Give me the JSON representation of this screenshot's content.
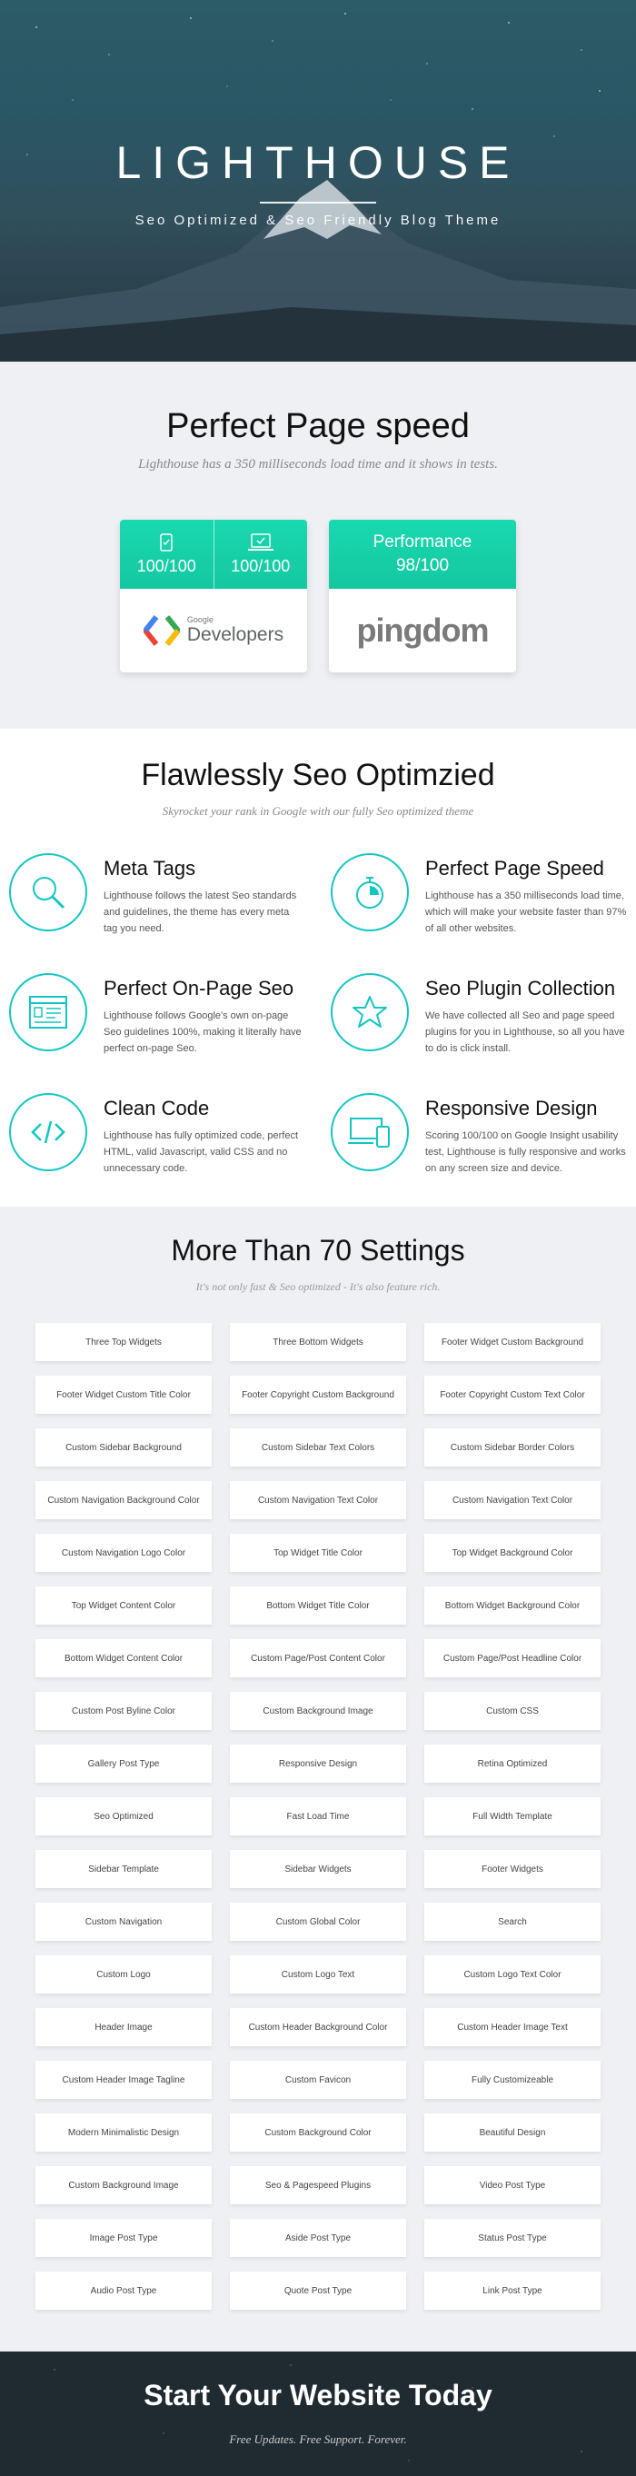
{
  "hero": {
    "title": "LIGHTHOUSE",
    "subtitle": "Seo Optimized & Seo Friendly Blog Theme"
  },
  "speed": {
    "title": "Perfect Page speed",
    "subtitle": "Lighthouse has a 350 milliseconds load time and it shows in tests.",
    "google_card": {
      "mobile_icon": "mobile-icon",
      "mobile_score": "100/100",
      "desktop_icon": "laptop-icon",
      "desktop_score": "100/100",
      "logo_small": "Google",
      "logo_text": "Developers"
    },
    "pingdom_card": {
      "label": "Performance",
      "score": "98/100",
      "logo_text": "pingdom"
    }
  },
  "seo": {
    "title": "Flawlessly Seo Optimzied",
    "subtitle": "Skyrocket your rank in Google with our fully Seo optimized theme",
    "features": [
      {
        "icon": "search-icon",
        "title": "Meta Tags",
        "text": "Lighthouse follows the latest Seo standards and guidelines, the theme has every meta tag you need."
      },
      {
        "icon": "stopwatch-icon",
        "title": "Perfect Page Speed",
        "text": "Lighthouse has a 350 milliseconds load time, which will make your website faster than 97% of all other websites."
      },
      {
        "icon": "browser-icon",
        "title": "Perfect On-Page Seo",
        "text": "Lighthouse follows Google's own on-page Seo guidelines 100%, making it literally have perfect on-page Seo."
      },
      {
        "icon": "star-icon",
        "title": "Seo Plugin Collection",
        "text": "We have collected all Seo and page speed plugins for you in Lighthouse, so all you have to do is click install."
      },
      {
        "icon": "code-icon",
        "title": "Clean Code",
        "text": "Lighthouse has fully optimized code, perfect HTML, valid Javascript, valid CSS and no unnecessary code."
      },
      {
        "icon": "devices-icon",
        "title": "Responsive Design",
        "text": "Scoring 100/100 on Google Insight usability test, Lighthouse is fully responsive and works on any screen size and device."
      }
    ]
  },
  "settings": {
    "title": "More Than 70 Settings",
    "subtitle": "It's not only fast & Seo optimized - It's also feature rich.",
    "items": [
      "Three Top Widgets",
      "Three Bottom Widgets",
      "Footer Widget Custom Background",
      "Footer Widget Custom Title Color",
      "Footer Copyright Custom Background",
      "Footer Copyright Custom Text Color",
      "Custom Sidebar Background",
      "Custom Sidebar Text Colors",
      "Custom Sidebar Border Colors",
      "Custom Navigation Background Color",
      "Custom Navigation Text Color",
      "Custom Navigation Text Color",
      "Custom Navigation Logo Color",
      "Top Widget Title Color",
      "Top Widget Background Color",
      "Top Widget Content Color",
      "Bottom Widget Title Color",
      "Bottom Widget Background Color",
      "Bottom Widget Content Color",
      "Custom Page/Post Content Color",
      "Custom Page/Post Headline Color",
      "Custom Post Byline Color",
      "Custom Background Image",
      "Custom CSS",
      "Gallery Post Type",
      "Responsive Design",
      "Retina Optimized",
      "Seo Optimized",
      "Fast Load Time",
      "Full Width Template",
      "Sidebar Template",
      "Sidebar Widgets",
      "Footer Widgets",
      "Custom Navigation",
      "Custom Global Color",
      "Search",
      "Custom Logo",
      "Custom Logo Text",
      "Custom Logo Text Color",
      "Header Image",
      "Custom Header Background Color",
      "Custom Header Image Text",
      "Custom Header Image Tagline",
      "Custom Favicon",
      "Fully Customizeable",
      "Modern Minimalistic Design",
      "Custom Background Color",
      "Beautiful Design",
      "Custom Background Image",
      "Seo & Pagespeed Plugins",
      "Video Post Type",
      "Image Post Type",
      "Aside Post Type",
      "Status Post Type",
      "Audio Post Type",
      "Quote Post Type",
      "Link Post Type"
    ]
  },
  "cta": {
    "title": "Start Your Website Today",
    "subtitle": "Free Updates. Free Support. Forever."
  },
  "colors": {
    "accent": "#13c6c3",
    "card_green": "#19d8b0",
    "hero_dark": "#2a5664"
  }
}
